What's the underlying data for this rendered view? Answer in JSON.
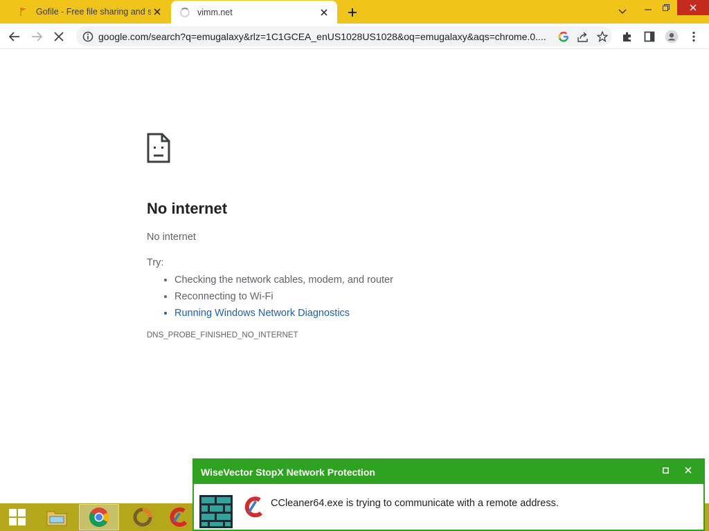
{
  "browser": {
    "tabs": [
      {
        "title": "Gofile - Free file sharing and storage",
        "favicon": "gofile-favicon-icon",
        "active": false
      },
      {
        "title": "vimm.net",
        "favicon": "loading-spinner-icon",
        "active": true
      }
    ],
    "address_bar": {
      "url": "google.com/search?q=emugalaxy&rlz=1C1GCEA_enUS1028US1028&oq=emugalaxy&aqs=chrome.0...."
    }
  },
  "error_page": {
    "title": "No internet",
    "subtitle": "No internet",
    "try_label": "Try:",
    "suggestions": [
      "Checking the network cables, modem, and router",
      "Reconnecting to Wi-Fi",
      "Running Windows Network Diagnostics"
    ],
    "error_code": "DNS_PROBE_FINISHED_NO_INTERNET"
  },
  "notification": {
    "title": "WiseVector StopX Network Protection",
    "message": "CCleaner64.exe is trying to communicate with a remote address."
  },
  "colors": {
    "tabstrip_bg": "#f0c419",
    "taskbar_bg": "#b4a81a",
    "notification_green": "#2ea321",
    "link_blue": "#1a5fb4"
  },
  "taskbar": {
    "items": [
      "start-button",
      "file-explorer-icon",
      "chrome-icon",
      "avast-cleanup-icon",
      "ccleaner-icon"
    ]
  }
}
